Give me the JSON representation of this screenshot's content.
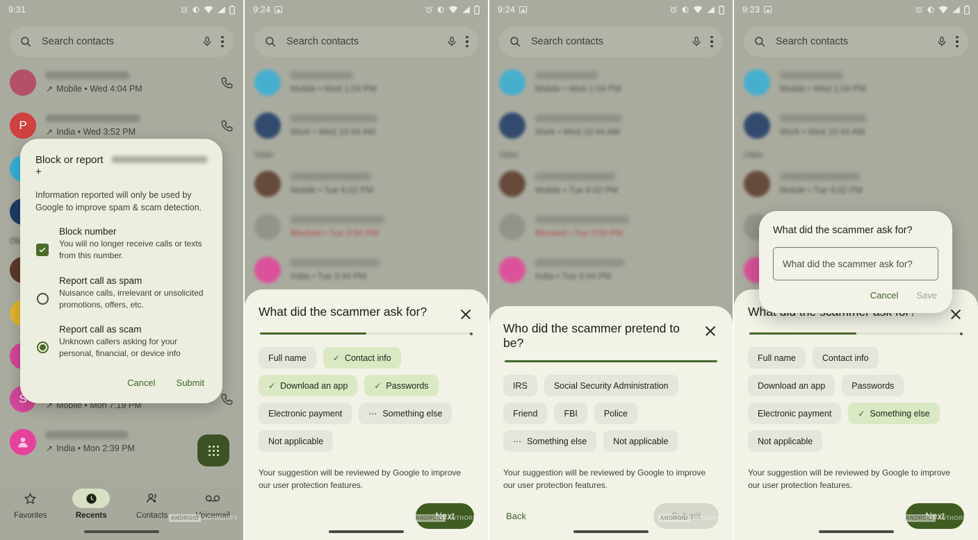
{
  "watermark": {
    "brand": "ANDROID",
    "suffix": "AUTHORITY"
  },
  "common": {
    "search_placeholder": "Search contacts",
    "section_older": "Older",
    "note": "Your suggestion will be reviewed by Google to improve our user protection features.",
    "close_label": "Close"
  },
  "panel1": {
    "status": {
      "time": "9:31"
    },
    "calls": [
      {
        "subtitle": "Mobile • Wed 4:04 PM",
        "arrow": "↗",
        "avatar_color": "#b5506a",
        "initial": "",
        "blurred_name": true
      },
      {
        "subtitle": "India • Wed 3:52 PM",
        "arrow": "↗",
        "avatar_color": "#cf4040",
        "initial": "P",
        "blurred_name": true
      },
      {
        "subtitle": "",
        "arrow": "",
        "avatar_color": "#35b0d6",
        "initial": "",
        "blurred_name": true
      },
      {
        "subtitle": "",
        "arrow": "",
        "avatar_color": "#1d3a66",
        "initial": "",
        "blurred_name": true
      },
      {
        "subtitle": "",
        "arrow": "",
        "avatar_color": "#5b3a2a",
        "initial": "",
        "blurred_name": true
      },
      {
        "subtitle": "",
        "arrow": "",
        "avatar_color": "#e0b52f",
        "initial": "",
        "blurred_name": true
      },
      {
        "subtitle": "",
        "arrow": "",
        "avatar_color": "#d4469a",
        "initial": "",
        "blurred_name": true
      },
      {
        "subtitle": "Mobile • Mon 7:19 PM",
        "arrow": "↗",
        "avatar_color": "#d4469a",
        "initial": "S",
        "blurred_name": true
      },
      {
        "subtitle": "India • Mon 2:39 PM",
        "arrow": "↗",
        "avatar_color": "#e5429b",
        "initial": "",
        "blurred_name": true
      }
    ],
    "dialog": {
      "title_prefix": "Block or report +",
      "body": "Information reported will only be used by Google to improve spam & scam detection.",
      "options": [
        {
          "title": "Block number",
          "desc": "You will no longer receive calls or texts from this number.",
          "control": "checkbox",
          "checked": true
        },
        {
          "title": "Report call as spam",
          "desc": "Nuisance calls, irrelevant or unsolicited promotions, offers, etc.",
          "control": "radio",
          "checked": false
        },
        {
          "title": "Report call as scam",
          "desc": "Unknown callers asking for your personal, financial, or device info",
          "control": "radio",
          "checked": true
        }
      ],
      "cancel": "Cancel",
      "submit": "Submit"
    },
    "nav": [
      {
        "label": "Favorites",
        "icon": "star-icon",
        "active": false
      },
      {
        "label": "Recents",
        "icon": "clock-icon",
        "active": true
      },
      {
        "label": "Contacts",
        "icon": "people-icon",
        "active": false
      },
      {
        "label": "Voicemail",
        "icon": "voicemail-icon",
        "active": false
      }
    ],
    "fab": "dialpad-icon"
  },
  "panel2": {
    "status": {
      "time": "9:24"
    },
    "sheet": {
      "title": "What did the scammer ask for?",
      "progress_percent": 50,
      "chips": [
        {
          "label": "Full name",
          "selected": false,
          "leading": "none"
        },
        {
          "label": "Contact info",
          "selected": true,
          "leading": "check"
        },
        {
          "label": "Download an app",
          "selected": true,
          "leading": "check"
        },
        {
          "label": "Passwords",
          "selected": true,
          "leading": "check"
        },
        {
          "label": "Electronic payment",
          "selected": false,
          "leading": "none"
        },
        {
          "label": "Something else",
          "selected": false,
          "leading": "ellipsis"
        },
        {
          "label": "Not applicable",
          "selected": false,
          "leading": "none"
        }
      ],
      "primary_button": "Next"
    }
  },
  "panel3": {
    "status": {
      "time": "9:24"
    },
    "sheet": {
      "title": "Who did the scammer pretend to be?",
      "progress_percent": 100,
      "chips": [
        {
          "label": "IRS",
          "selected": false,
          "leading": "none"
        },
        {
          "label": "Social Security Administration",
          "selected": false,
          "leading": "none"
        },
        {
          "label": "Friend",
          "selected": false,
          "leading": "none"
        },
        {
          "label": "FBI",
          "selected": false,
          "leading": "none"
        },
        {
          "label": "Police",
          "selected": false,
          "leading": "none"
        },
        {
          "label": "Something else",
          "selected": false,
          "leading": "ellipsis"
        },
        {
          "label": "Not applicable",
          "selected": false,
          "leading": "none"
        }
      ],
      "back_button": "Back",
      "primary_button": "Submit",
      "primary_disabled": true
    }
  },
  "panel4": {
    "status": {
      "time": "9:23"
    },
    "sheet": {
      "title": "What did the scammer ask for?",
      "progress_percent": 50,
      "chips": [
        {
          "label": "Full name",
          "selected": false,
          "leading": "none"
        },
        {
          "label": "Contact info",
          "selected": false,
          "leading": "none"
        },
        {
          "label": "Download an app",
          "selected": false,
          "leading": "none"
        },
        {
          "label": "Passwords",
          "selected": false,
          "leading": "none"
        },
        {
          "label": "Electronic payment",
          "selected": false,
          "leading": "none"
        },
        {
          "label": "Something else",
          "selected": true,
          "leading": "check"
        },
        {
          "label": "Not applicable",
          "selected": false,
          "leading": "none"
        }
      ],
      "primary_button": "Next"
    },
    "mini_dialog": {
      "title": "What did the scammer ask for?",
      "input_placeholder": "What did the scammer ask for?",
      "input_value": "",
      "cancel": "Cancel",
      "save": "Save",
      "save_disabled": true
    }
  }
}
